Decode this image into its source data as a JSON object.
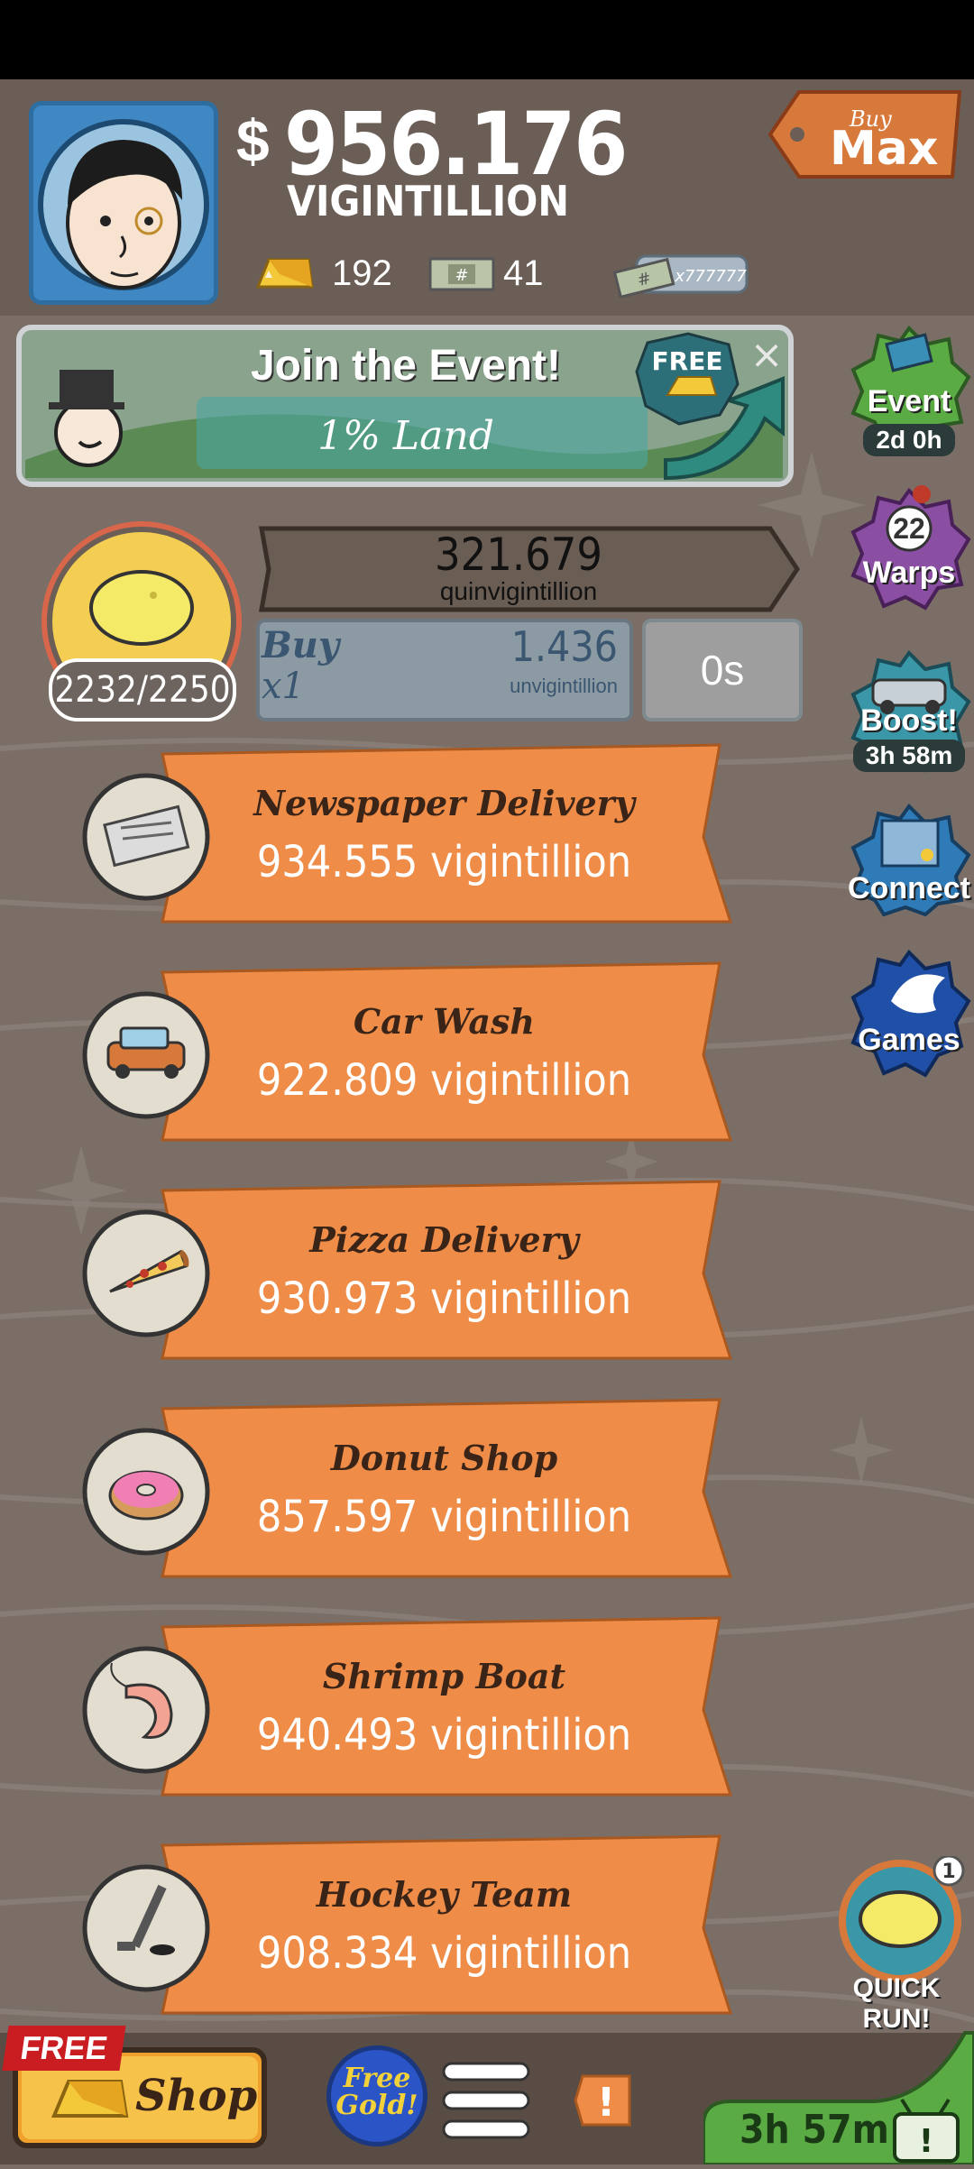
{
  "header": {
    "cash_symbol": "$",
    "cash_amount": "956.176",
    "cash_unit": "VIGINTILLION",
    "gold_count": "192",
    "megabucks_count": "41",
    "bill_label": "x777777",
    "buy_max_small": "Buy",
    "buy_max_big": "Max"
  },
  "event_banner": {
    "title": "Join the Event!",
    "subtitle": "1% Land",
    "free_badge": "FREE",
    "close_symbol": "×"
  },
  "side_buttons": {
    "event_label": "Event",
    "event_timer": "2d 0h",
    "warps_count": "22",
    "warps_label": "Warps",
    "boost_label": "Boost!",
    "boost_timer": "3h 58m",
    "connect_label": "Connect",
    "games_label": "Games"
  },
  "lemonade": {
    "progress": "2232/2250",
    "revenue_amount": "321.679",
    "revenue_unit": "quinvigintillion",
    "buy_label": "Buy",
    "buy_multiplier": "x1",
    "buy_cost": "1.436",
    "buy_cost_unit": "unvigintillion",
    "timer": "0s"
  },
  "businesses": [
    {
      "name": "Newspaper Delivery",
      "value": "934.555 vigintillion",
      "icon": "newspaper-icon"
    },
    {
      "name": "Car Wash",
      "value": "922.809 vigintillion",
      "icon": "car-icon"
    },
    {
      "name": "Pizza Delivery",
      "value": "930.973 vigintillion",
      "icon": "pizza-icon"
    },
    {
      "name": "Donut Shop",
      "value": "857.597 vigintillion",
      "icon": "donut-icon"
    },
    {
      "name": "Shrimp Boat",
      "value": "940.493 vigintillion",
      "icon": "shrimp-icon"
    },
    {
      "name": "Hockey Team",
      "value": "908.334 vigintillion",
      "icon": "hockey-icon"
    }
  ],
  "quick_run": {
    "label": "QUICK RUN!",
    "count": "1"
  },
  "bottom": {
    "free_tag": "FREE",
    "shop_label": "Shop",
    "free_gold_label": "Free Gold!",
    "timer": "3h 57m",
    "alert_symbol": "!"
  },
  "colors": {
    "background": "#7a6e66",
    "business_banner": "#ee8c48",
    "event_green": "#5bab45",
    "warps_purple": "#8a4fa3",
    "boost_teal": "#3a97a8",
    "games_blue": "#1f4fa6",
    "lemon_yellow": "#f4ea68"
  }
}
